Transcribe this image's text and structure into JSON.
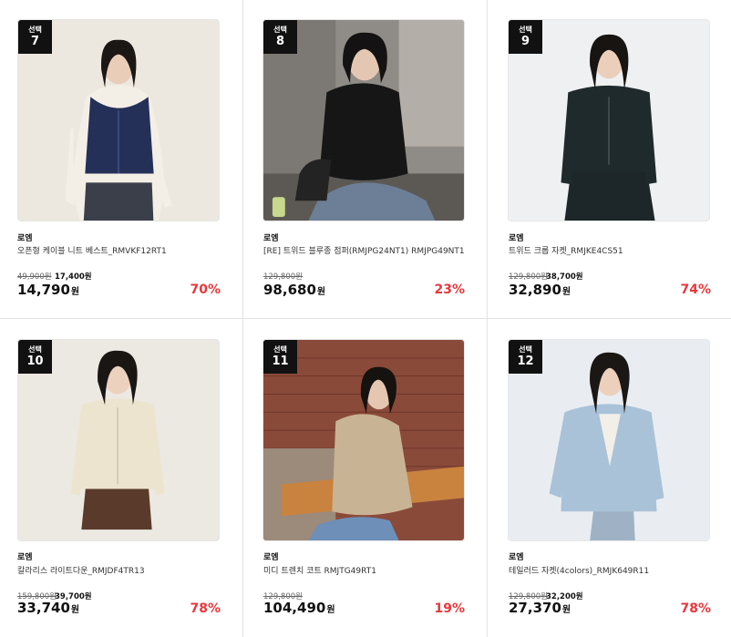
{
  "products": [
    {
      "badge_label": "선택",
      "badge_num": "7",
      "brand": "로엠",
      "name": "오픈형 케이블 니트 베스트_RMVKF12RT1",
      "orig_price": "49,900원",
      "coupon_price": "17,400원",
      "price": "14,790",
      "won": "원",
      "rate": "70%",
      "image": "woman-navy-cable-vest-photo"
    },
    {
      "badge_label": "선택",
      "badge_num": "8",
      "brand": "로엠",
      "name": "[RE] 트위드 블루종 점퍼(RMJPG24NT1) RMJPG49NT1",
      "orig_price": "129,800원",
      "coupon_price": "",
      "price": "98,680",
      "won": "원",
      "rate": "23%",
      "image": "woman-black-blouson-jacket-photo"
    },
    {
      "badge_label": "선택",
      "badge_num": "9",
      "brand": "로엠",
      "name": "트위드 크롭 자켓_RMJKE4CS51",
      "orig_price": "129,800원",
      "coupon_price": "38,700원",
      "price": "32,890",
      "won": "원",
      "rate": "74%",
      "image": "woman-dark-green-tweed-jacket-photo"
    },
    {
      "badge_label": "선택",
      "badge_num": "10",
      "brand": "로엠",
      "name": "칼라리스 라이트다운_RMJDF4TR13",
      "orig_price": "159,800원",
      "coupon_price": "39,700원",
      "price": "33,740",
      "won": "원",
      "rate": "78%",
      "image": "woman-cream-light-down-photo"
    },
    {
      "badge_label": "선택",
      "badge_num": "11",
      "brand": "로엠",
      "name": "미디 트렌치 코트 RMJTG49RT1",
      "orig_price": "129,800원",
      "coupon_price": "",
      "price": "104,490",
      "won": "원",
      "rate": "19%",
      "image": "woman-beige-trench-coat-photo"
    },
    {
      "badge_label": "선택",
      "badge_num": "12",
      "brand": "로엠",
      "name": "테일러드 자켓(4colors)_RMJK649R11",
      "orig_price": "129,800원",
      "coupon_price": "32,200원",
      "price": "27,370",
      "won": "원",
      "rate": "78%",
      "image": "woman-light-blue-tailored-jacket-photo"
    }
  ],
  "colors": {
    "accent_rate": "#e8383d",
    "badge_bg": "#111111"
  }
}
